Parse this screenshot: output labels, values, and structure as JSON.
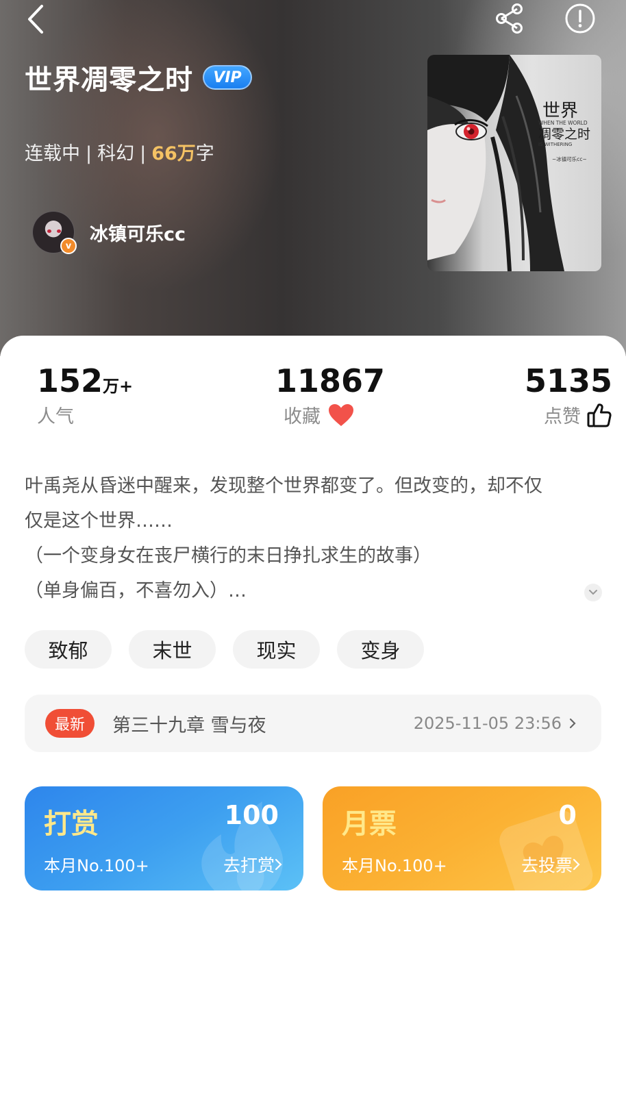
{
  "header": {
    "back_icon": "chevron-left-icon",
    "share_icon": "share-icon",
    "info_icon": "info-icon"
  },
  "book": {
    "title": "世界凋零之时",
    "vip_badge": "VIP",
    "status": "连载中",
    "separator": "|",
    "genre": "科幻",
    "word_count_value": "66万",
    "word_count_unit": "字"
  },
  "author": {
    "name": "冰镇可乐cc",
    "badge": "v"
  },
  "cover": {
    "title_line1": "世界",
    "subtitle_line1": "WHEN THE WORLD",
    "title_line2": "凋零之时",
    "subtitle_line2": "IS WITHERING",
    "author": "~冰镇可乐cc~"
  },
  "stats": {
    "popularity": {
      "value": "152",
      "unit": "万+",
      "label": "人气"
    },
    "favorites": {
      "value": "11867",
      "label": "收藏",
      "icon": "heart-icon"
    },
    "likes": {
      "value": "5135",
      "label": "点赞",
      "icon": "thumbs-up-icon"
    }
  },
  "synopsis": {
    "line1": "叶禹尧从昏迷中醒来，发现整个世界都变了。但改变的，却不仅",
    "line2": "仅是这个世界……",
    "line3": "（一个变身女在丧尸横行的末日挣扎求生的故事）",
    "line4": "（单身偏百，不喜勿入）…",
    "expand_icon": "chevron-down-icon"
  },
  "tags": [
    "致郁",
    "末世",
    "现实",
    "变身"
  ],
  "latest_chapter": {
    "badge": "最新",
    "title": "第三十九章  雪与夜",
    "time": "2025-11-05 23:56"
  },
  "reward": {
    "title": "打赏",
    "count": "100",
    "rank": "本月No.100+",
    "link": "去打赏"
  },
  "monthly_ticket": {
    "title": "月票",
    "count": "0",
    "rank": "本月No.100+",
    "link": "去投票"
  },
  "colors": {
    "accent_gold": "#f4c264",
    "vip_blue": "#1a7ff0",
    "latest_red": "#f04e36",
    "heart_red": "#f2524a",
    "reward_blue": "#3d9ff0",
    "ticket_orange": "#fbb133"
  }
}
